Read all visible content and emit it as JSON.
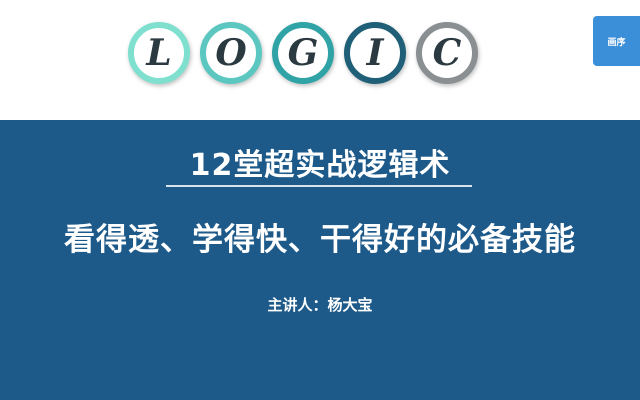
{
  "logo": {
    "letters": [
      "L",
      "O",
      "G",
      "I",
      "C"
    ]
  },
  "corner_button": {
    "label": "画序"
  },
  "slide": {
    "title": "12堂超实战逻辑术",
    "subtitle": "看得透、学得快、干得好的必备技能",
    "speaker": "主讲人：杨大宝"
  },
  "colors": {
    "panel_blue": "#1d5a8a",
    "ring_1": "#7fe0d0",
    "ring_2": "#5cc7c0",
    "ring_3": "#2fa3a6",
    "ring_4": "#1f6078",
    "ring_5": "#8a8f92",
    "button_blue": "#3b8fd8"
  }
}
